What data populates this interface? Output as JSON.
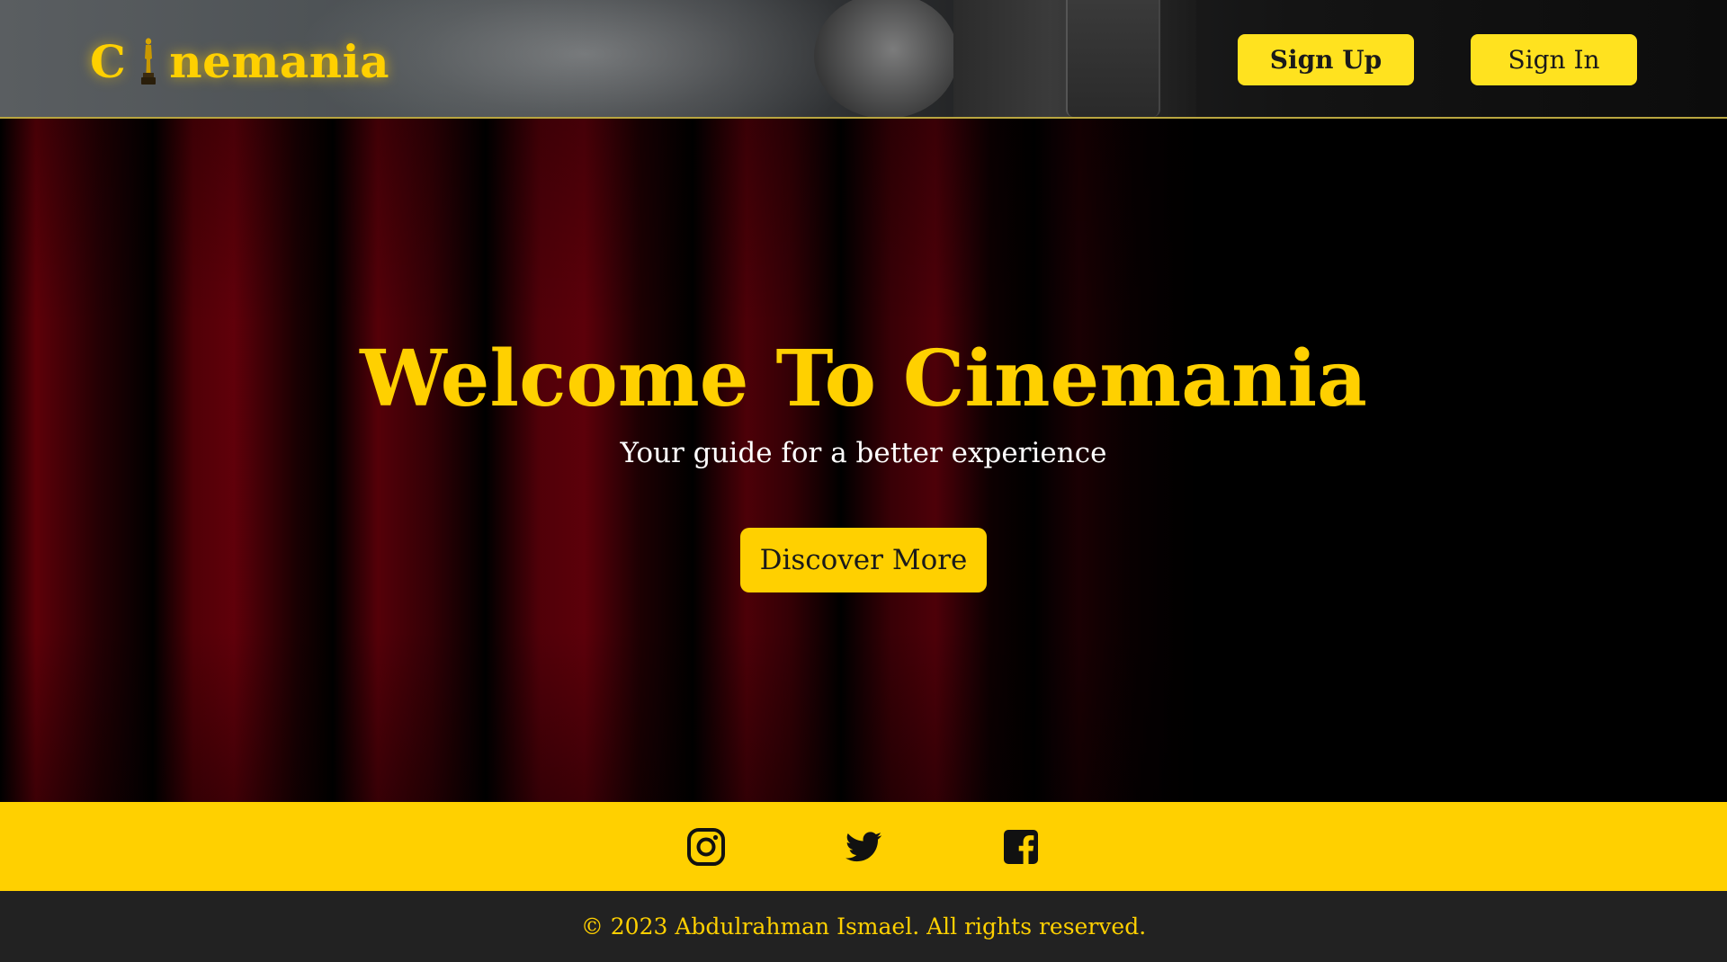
{
  "header": {
    "logo": {
      "prefix": "C",
      "suffix": "nemania",
      "icon": "oscar-statuette-icon"
    },
    "buttons": {
      "sign_up": "Sign Up",
      "sign_in": "Sign In"
    }
  },
  "hero": {
    "title": "Welcome To Cinemania",
    "subtitle": "Your guide for a better experience",
    "cta": "Discover More"
  },
  "social": {
    "icons": [
      "instagram-icon",
      "twitter-icon",
      "facebook-icon"
    ]
  },
  "footer": {
    "copyright": "© 2023 Abdulrahman Ismael. All rights reserved."
  },
  "colors": {
    "accent": "#ffd000",
    "button_header": "#ffe21f",
    "footer_bg": "#222222",
    "text_dark": "#1a1a1a",
    "curtain_red": "#6e000a"
  }
}
